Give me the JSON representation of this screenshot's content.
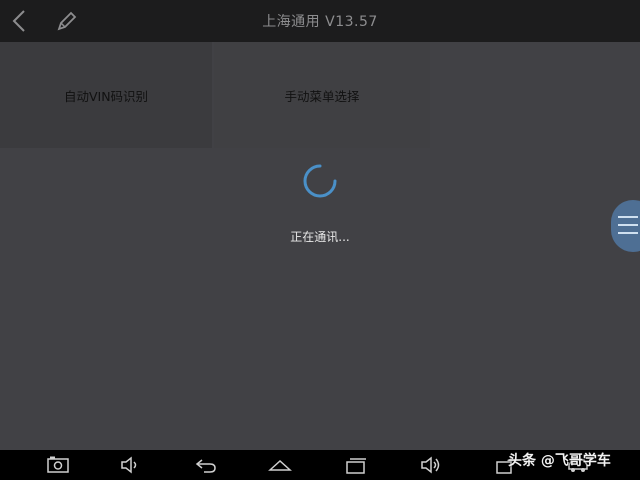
{
  "header": {
    "title": "上海通用 V13.57",
    "back_icon": "back-icon",
    "edit_icon": "edit-icon"
  },
  "menu": {
    "tiles": [
      {
        "label": "自动VIN码识别"
      },
      {
        "label": "手动菜单选择"
      }
    ]
  },
  "status": {
    "text": "正在通讯...",
    "spinner_icon": "loading-spinner-icon"
  },
  "side_menu": {
    "icon": "hamburger-menu-icon"
  },
  "navbar": {
    "buttons": [
      "screenshot-icon",
      "volume-down-icon",
      "back-icon",
      "home-icon",
      "recent-apps-icon",
      "volume-up-icon",
      "add-window-icon",
      "car-icon"
    ]
  },
  "watermark": {
    "text": "头条 @飞哥学车"
  },
  "colors": {
    "background": "#414145",
    "topbar": "#1c1c1d",
    "tile": "#3b3b3e",
    "spinner": "#4a90c8",
    "side_menu": "#4e6f94"
  }
}
